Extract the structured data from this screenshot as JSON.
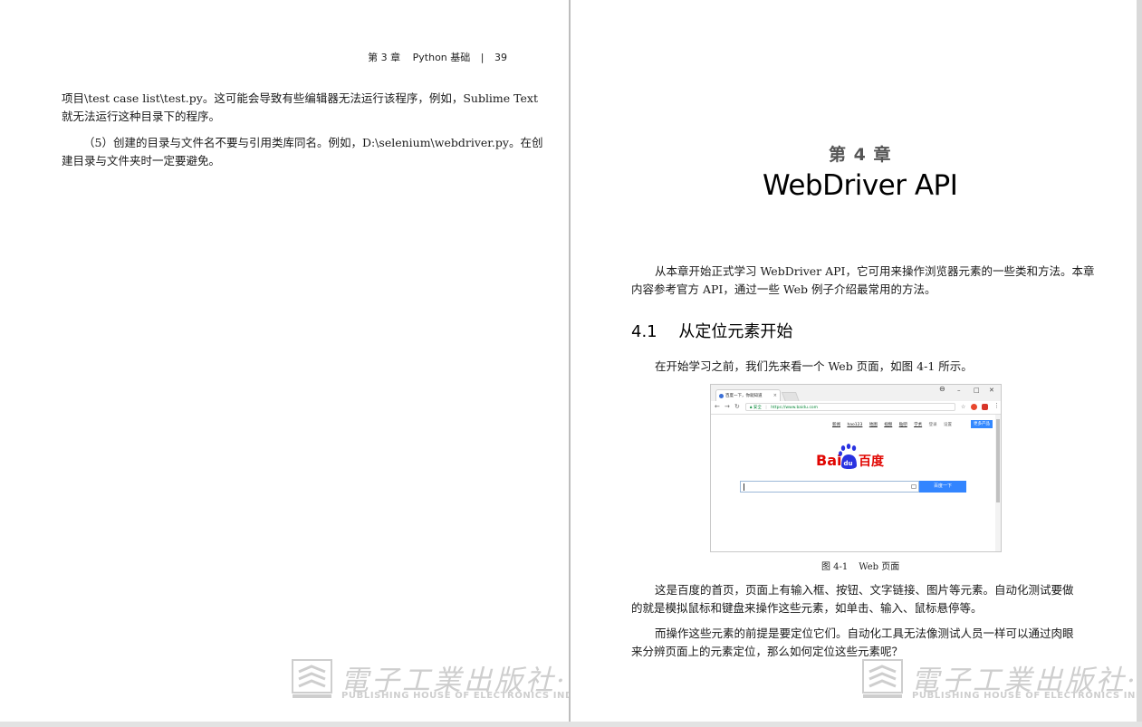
{
  "left_page": {
    "running_header": {
      "chapter": "第 3 章",
      "title": "Python 基础",
      "separator": "|",
      "page_number": "39"
    },
    "paragraphs": [
      {
        "lines": [
          "项目\\test case list\\test.py。这可能会导致有些编辑器无法运行该程序，例如，Sublime Text",
          "就无法运行这种目录下的程序。"
        ]
      },
      {
        "lines": [
          "（5）创建的目录与文件名不要与引用类库同名。例如，D:\\selenium\\webdriver.py。在创",
          "建目录与文件夹时一定要避免。"
        ]
      }
    ]
  },
  "right_page": {
    "chapter_number": "第 4 章",
    "chapter_title": "WebDriver API",
    "intro": [
      "从本章开始正式学习 WebDriver API，它可用来操作浏览器元素的一些类和方法。本章",
      "内容参考官方 API，通过一些 Web 例子介绍最常用的方法。"
    ],
    "section": {
      "number": "4.1",
      "title": "从定位元素开始"
    },
    "section_lead": "在开始学习之前，我们先来看一个 Web 页面，如图 4-1 所示。",
    "figure": {
      "tab_title": "百度一下，你就知道",
      "window_controls": [
        "–",
        "□",
        "✕"
      ],
      "secure_label": "安全",
      "url": "https://www.baidu.com",
      "top_links": [
        "新闻",
        "hao123",
        "地图",
        "视频",
        "贴吧",
        "学术",
        "登录",
        "设置"
      ],
      "more_button": "更多产品",
      "search_button": "百度一下",
      "logo_text_left": "Bai",
      "logo_text_right": "百度",
      "logo_paw_text": "du",
      "caption_number": "图 4-1",
      "caption_text": "Web 页面"
    },
    "para1": [
      "这是百度的首页，页面上有输入框、按钮、文字链接、图片等元素。自动化测试要做",
      "的就是模拟鼠标和键盘来操作这些元素，如单击、输入、鼠标悬停等。"
    ],
    "para2": [
      "而操作这些元素的前提是要定位它们。自动化工具无法像测试人员一样可以通过肉眼",
      "来分辨页面上的元素定位，那么如何定位这些元素呢？"
    ]
  },
  "watermark": {
    "chinese": "電子工業出版社·",
    "english": "PUBLISHING HOUSE OF ELECTRONICS INDUSTRY"
  }
}
